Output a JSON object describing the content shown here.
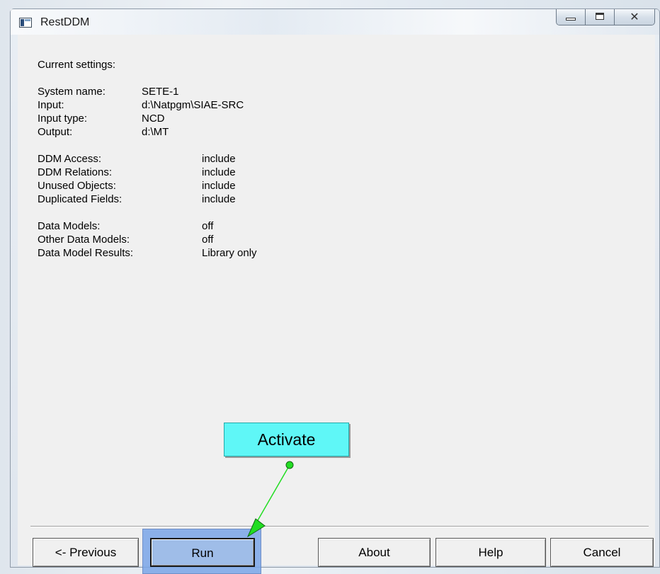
{
  "window": {
    "title": "RestDDM",
    "close_glyph": "✕"
  },
  "settings": {
    "heading": "Current settings:",
    "system": [
      {
        "key": "System name:",
        "value": "SETE-1"
      },
      {
        "key": "Input:",
        "value": "d:\\Natpgm\\SIAE-SRC"
      },
      {
        "key": "Input type:",
        "value": "NCD"
      },
      {
        "key": "Output:",
        "value": "d:\\MT"
      }
    ],
    "ddm": [
      {
        "key": "DDM Access:",
        "value": "include"
      },
      {
        "key": "DDM Relations:",
        "value": "include"
      },
      {
        "key": "Unused Objects:",
        "value": "include"
      },
      {
        "key": "Duplicated Fields:",
        "value": "include"
      }
    ],
    "models": [
      {
        "key": "Data Models:",
        "value": "off"
      },
      {
        "key": "Other Data Models:",
        "value": "off"
      },
      {
        "key": "Data Model Results:",
        "value": "Library only"
      }
    ]
  },
  "buttons": {
    "previous": "<- Previous",
    "run": "Run",
    "about": "About",
    "help": "Help",
    "cancel": "Cancel"
  },
  "annotation": {
    "callout_text": "Activate",
    "callout_color": "#5ff7f7",
    "highlight_color": "#7aa6e8",
    "arrow_color": "#22dd22"
  }
}
